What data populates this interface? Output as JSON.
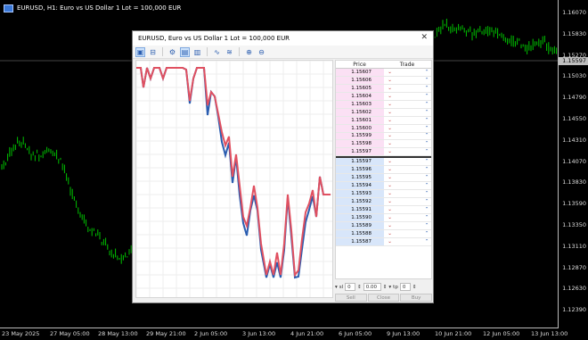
{
  "chart": {
    "title": "EURUSD, H1:  Euro vs US Dollar 1 Lot = 100,000 EUR",
    "current_price": "1.15597",
    "price_labels": [
      "1.16070",
      "1.15830",
      "1.15270",
      "1.15030",
      "1.14790",
      "1.14550",
      "1.14310",
      "1.14070",
      "1.13830",
      "1.13590",
      "1.13350",
      "1.13110",
      "1.12870",
      "1.12630",
      "1.12390"
    ],
    "time_labels": [
      "23 May 2025",
      "27 May 05:00",
      "28 May 13:00",
      "29 May 21:00",
      "2 Jun 05:00",
      "3 Jun 13:00",
      "4 Jun 21:00",
      "6 Jun 05:00",
      "9 Jun 13:00",
      "10 Jun 21:00",
      "12 Jun 05:00",
      "13 Jun 13:00"
    ],
    "colors": {
      "bull": "#00c000",
      "background": "#000000"
    }
  },
  "dialog": {
    "title": "EURUSD, Euro vs US Dollar 1 Lot = 100,000 EUR",
    "close_glyph": "✕",
    "toolbar_icons": [
      "chart-icon",
      "lock-icon",
      "settings-icon",
      "depth-icon",
      "bars-icon",
      "ticks-icon",
      "lines-icon",
      "zoom-in-icon",
      "zoom-out-icon"
    ],
    "dom_headers": {
      "price": "Price",
      "trade": "Trade"
    },
    "ask_prices": [
      "1.15607",
      "1.15606",
      "1.15605",
      "1.15604",
      "1.15603",
      "1.15602",
      "1.15601",
      "1.15600",
      "1.15599",
      "1.15598",
      "1.15597"
    ],
    "bid_prices": [
      "1.15597",
      "1.15596",
      "1.15595",
      "1.15594",
      "1.15593",
      "1.15592",
      "1.15591",
      "1.15590",
      "1.15589",
      "1.15588",
      "1.15587"
    ],
    "controls": {
      "sl_label": "sl",
      "sl_value": "0",
      "lot_value": "0.00",
      "tp_label": "tp",
      "tp_value": "0"
    },
    "buttons": {
      "sell": "Sell",
      "close": "Close",
      "buy": "Buy"
    },
    "colors": {
      "ask_line": "#e05060",
      "bid_line": "#2a5db0"
    }
  }
}
